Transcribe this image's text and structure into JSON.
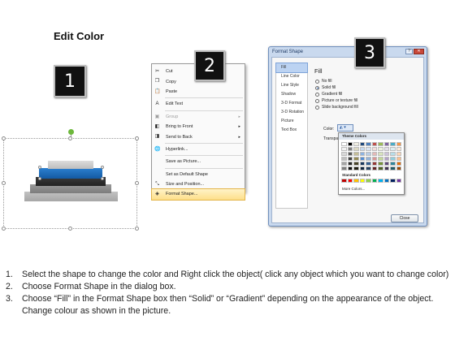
{
  "title": "Edit Color",
  "badges": [
    "1",
    "2",
    "3"
  ],
  "context_menu": {
    "items": [
      {
        "label": "Cut",
        "icon": "scissors-icon",
        "glyph": "✂",
        "disabled": false,
        "submenu": false
      },
      {
        "label": "Copy",
        "icon": "copy-icon",
        "glyph": "❐",
        "disabled": false,
        "submenu": false
      },
      {
        "label": "Paste",
        "icon": "paste-icon",
        "glyph": "📋",
        "disabled": false,
        "submenu": false
      },
      {
        "sep": true
      },
      {
        "label": "Edit Text",
        "icon": "edit-text-icon",
        "glyph": "A",
        "disabled": false,
        "submenu": false
      },
      {
        "sep": true
      },
      {
        "label": "Group",
        "icon": "group-icon",
        "glyph": "▣",
        "disabled": true,
        "submenu": true
      },
      {
        "label": "Bring to Front",
        "icon": "bring-front-icon",
        "glyph": "◧",
        "disabled": false,
        "submenu": true
      },
      {
        "label": "Send to Back",
        "icon": "send-back-icon",
        "glyph": "◨",
        "disabled": false,
        "submenu": true
      },
      {
        "sep": true
      },
      {
        "label": "Hyperlink...",
        "icon": "hyperlink-icon",
        "glyph": "🌐",
        "disabled": false,
        "submenu": false
      },
      {
        "sep": true
      },
      {
        "label": "Save as Picture...",
        "icon": "",
        "glyph": "",
        "disabled": false,
        "submenu": false
      },
      {
        "sep": true
      },
      {
        "label": "Set as Default Shape",
        "icon": "",
        "glyph": "",
        "disabled": false,
        "submenu": false
      },
      {
        "label": "Size and Position...",
        "icon": "size-position-icon",
        "glyph": "⤡",
        "disabled": false,
        "submenu": false
      },
      {
        "label": "Format Shape...",
        "icon": "format-shape-icon",
        "glyph": "◈",
        "disabled": false,
        "submenu": false,
        "highlighted": true
      }
    ]
  },
  "dialog": {
    "title": "Format Shape",
    "nav": [
      "Fill",
      "Line Color",
      "Line Style",
      "Shadow",
      "3-D Format",
      "3-D Rotation",
      "Picture",
      "Text Box"
    ],
    "active_nav": "Fill",
    "fill_title": "Fill",
    "options": [
      {
        "label": "No fill",
        "selected": false
      },
      {
        "label": "Solid fill",
        "selected": true
      },
      {
        "label": "Gradient fill",
        "selected": false
      },
      {
        "label": "Picture or texture fill",
        "selected": false
      },
      {
        "label": "Slide background fill",
        "selected": false
      }
    ],
    "color_label": "Color:",
    "transparency_label": "Transpa",
    "palette": {
      "theme_label": "Theme Colors",
      "theme_rows": [
        [
          "#ffffff",
          "#000000",
          "#eeece1",
          "#1f497d",
          "#4f81bd",
          "#c0504d",
          "#9bbb59",
          "#8064a2",
          "#4bacc6",
          "#f79646"
        ],
        [
          "#f2f2f2",
          "#7f7f7f",
          "#ddd9c3",
          "#c6d9f0",
          "#dbe5f1",
          "#f2dcdb",
          "#ebf1dd",
          "#e5e0ec",
          "#dbeef3",
          "#fdeada"
        ],
        [
          "#d8d8d8",
          "#595959",
          "#c4bd97",
          "#8db3e2",
          "#b8cce4",
          "#e5b9b7",
          "#d7e3bc",
          "#ccc1d9",
          "#b7dde8",
          "#fbd5b5"
        ],
        [
          "#bfbfbf",
          "#3f3f3f",
          "#938953",
          "#548dd4",
          "#95b3d7",
          "#d99694",
          "#c3d69b",
          "#b2a2c7",
          "#92cddc",
          "#fac08f"
        ],
        [
          "#a5a5a5",
          "#262626",
          "#494429",
          "#17365d",
          "#366092",
          "#953734",
          "#76923c",
          "#5f497a",
          "#31859b",
          "#e36c09"
        ],
        [
          "#7f7f7f",
          "#0c0c0c",
          "#1d1b10",
          "#0f243e",
          "#244061",
          "#632423",
          "#4f6128",
          "#3f3151",
          "#205867",
          "#974806"
        ]
      ],
      "standard_label": "Standard Colors",
      "standard": [
        "#c00000",
        "#ff0000",
        "#ffc000",
        "#ffff00",
        "#92d050",
        "#00b050",
        "#00b0f0",
        "#0070c0",
        "#002060",
        "#7030a0"
      ],
      "more_label": "More Colors..."
    },
    "close_label": "Close"
  },
  "instructions": [
    {
      "num": "1.",
      "text": "Select the shape to change the color and Right click the object( click any object which you want to change color)"
    },
    {
      "num": "2.",
      "text": "Choose Format Shape in the dialog box."
    },
    {
      "num": "3.",
      "text": "Choose “Fill” in the Format Shape box then “Solid” or “Gradient” depending on the appearance of the object. Change colour as shown in the picture."
    }
  ]
}
